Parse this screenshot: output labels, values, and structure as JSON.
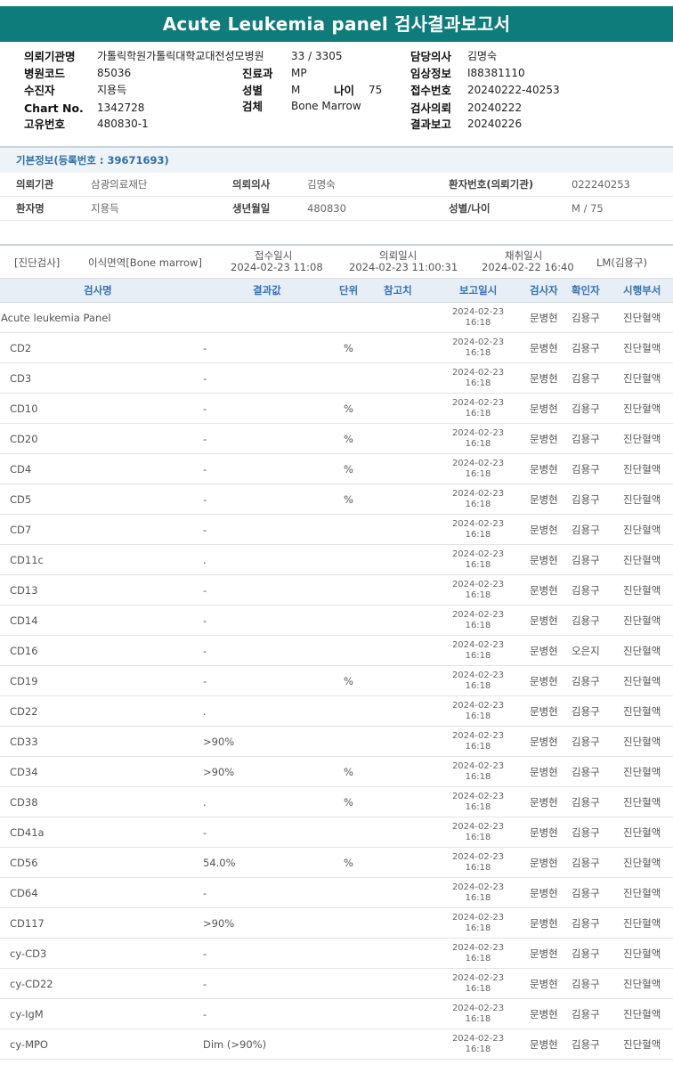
{
  "title": "Acute Leukemia panel 검사결과보고서",
  "header": {
    "institution_label": "의뢰기관명",
    "institution_value": "가톨릭학원가톨릭대학교대전성모병원",
    "ward_value": "33 / 3305",
    "doctor_label": "담당의사",
    "doctor_value": "김명숙",
    "hospital_code_label": "병원코드",
    "hospital_code_value": "85036",
    "dept_label": "진료과",
    "dept_value": "MP",
    "clinical_label": "임상정보",
    "clinical_value": "I88381110",
    "patient_label": "수진자",
    "patient_value": "지용득",
    "sex_label": "성별",
    "sex_value": "M",
    "age_label": "나이",
    "age_value": "75",
    "receipt_label": "접수번호",
    "receipt_value": "20240222-40253",
    "chart_label": "Chart No.",
    "chart_value": "1342728",
    "specimen_label": "검체",
    "specimen_value": "Bone Marrow",
    "request_label": "검사의뢰",
    "request_value": "20240222",
    "unique_label": "고유번호",
    "unique_value": "480830-1",
    "report_label": "결과보고",
    "report_value": "20240226"
  },
  "basic_info": {
    "title": "기본정보(등록번호 : 39671693)",
    "institution_label": "의뢰기관",
    "institution_value": "삼광의료재단",
    "doctor_label": "의뢰의사",
    "doctor_value": "김명숙",
    "patient_no_label": "환자번호(의뢰기관)",
    "patient_no_value": "022240253",
    "name_label": "환자명",
    "name_value": "지용득",
    "birth_label": "생년월일",
    "birth_value": "480830",
    "sexage_label": "성별/나이",
    "sexage_value": "M / 75"
  },
  "specimen_line": {
    "category": "[진단검사]",
    "specimen": "이식면역[Bone marrow]",
    "receipt_label": "접수일시",
    "receipt_value": "2024-02-23 11:08",
    "request_label": "의뢰일시",
    "request_value": "2024-02-23 11:00:31",
    "collect_label": "채취일시",
    "collect_value": "2024-02-22 16:40",
    "lm": "LM(김용구)"
  },
  "table": {
    "headers": {
      "name": "검사명",
      "result": "결과값",
      "unit": "단위",
      "ref": "참고치",
      "report_date": "보고일시",
      "tech": "검사자",
      "confirm": "확인자",
      "dept": "시행부서"
    },
    "rows": [
      {
        "name": "Acute leukemia Panel",
        "result": "",
        "unit": "",
        "date": "2024-02-23",
        "time": "16:18",
        "tech": "문병현",
        "confirm": "김용구",
        "dept": "진단혈액"
      },
      {
        "name": "CD2",
        "result": "-",
        "unit": "%",
        "date": "2024-02-23",
        "time": "16:18",
        "tech": "문병현",
        "confirm": "김용구",
        "dept": "진단혈액"
      },
      {
        "name": "CD3",
        "result": "-",
        "unit": "",
        "date": "2024-02-23",
        "time": "16:18",
        "tech": "문병현",
        "confirm": "김용구",
        "dept": "진단혈액"
      },
      {
        "name": "CD10",
        "result": "-",
        "unit": "%",
        "date": "2024-02-23",
        "time": "16:18",
        "tech": "문병현",
        "confirm": "김용구",
        "dept": "진단혈액"
      },
      {
        "name": "CD20",
        "result": "-",
        "unit": "%",
        "date": "2024-02-23",
        "time": "16:18",
        "tech": "문병현",
        "confirm": "김용구",
        "dept": "진단혈액"
      },
      {
        "name": "CD4",
        "result": "-",
        "unit": "%",
        "date": "2024-02-23",
        "time": "16:18",
        "tech": "문병현",
        "confirm": "김용구",
        "dept": "진단혈액"
      },
      {
        "name": "CD5",
        "result": "-",
        "unit": "%",
        "date": "2024-02-23",
        "time": "16:18",
        "tech": "문병현",
        "confirm": "김용구",
        "dept": "진단혈액"
      },
      {
        "name": "CD7",
        "result": "-",
        "unit": "",
        "date": "2024-02-23",
        "time": "16:18",
        "tech": "문병현",
        "confirm": "김용구",
        "dept": "진단혈액"
      },
      {
        "name": "CD11c",
        "result": ".",
        "unit": "",
        "date": "2024-02-23",
        "time": "16:18",
        "tech": "문병현",
        "confirm": "김용구",
        "dept": "진단혈액"
      },
      {
        "name": "CD13",
        "result": "-",
        "unit": "",
        "date": "2024-02-23",
        "time": "16:18",
        "tech": "문병현",
        "confirm": "김용구",
        "dept": "진단혈액"
      },
      {
        "name": "CD14",
        "result": "-",
        "unit": "",
        "date": "2024-02-23",
        "time": "16:18",
        "tech": "문병현",
        "confirm": "김용구",
        "dept": "진단혈액"
      },
      {
        "name": "CD16",
        "result": "-",
        "unit": "",
        "date": "2024-02-23",
        "time": "16:18",
        "tech": "문병현",
        "confirm": "오은지",
        "dept": "진단혈액"
      },
      {
        "name": "CD19",
        "result": "-",
        "unit": "%",
        "date": "2024-02-23",
        "time": "16:18",
        "tech": "문병현",
        "confirm": "김용구",
        "dept": "진단혈액"
      },
      {
        "name": "CD22",
        "result": ".",
        "unit": "",
        "date": "2024-02-23",
        "time": "16:18",
        "tech": "문병현",
        "confirm": "김용구",
        "dept": "진단혈액"
      },
      {
        "name": "CD33",
        "result": ">90%",
        "unit": "",
        "date": "2024-02-23",
        "time": "16:18",
        "tech": "문병현",
        "confirm": "김용구",
        "dept": "진단혈액"
      },
      {
        "name": "CD34",
        "result": ">90%",
        "unit": "%",
        "date": "2024-02-23",
        "time": "16:18",
        "tech": "문병현",
        "confirm": "김용구",
        "dept": "진단혈액"
      },
      {
        "name": "CD38",
        "result": ".",
        "unit": "%",
        "date": "2024-02-23",
        "time": "16:18",
        "tech": "문병현",
        "confirm": "김용구",
        "dept": "진단혈액"
      },
      {
        "name": "CD41a",
        "result": "-",
        "unit": "",
        "date": "2024-02-23",
        "time": "16:18",
        "tech": "문병현",
        "confirm": "김용구",
        "dept": "진단혈액"
      },
      {
        "name": "CD56",
        "result": "54.0%",
        "unit": "%",
        "date": "2024-02-23",
        "time": "16:18",
        "tech": "문병현",
        "confirm": "김용구",
        "dept": "진단혈액"
      },
      {
        "name": "CD64",
        "result": "-",
        "unit": "",
        "date": "2024-02-23",
        "time": "16:18",
        "tech": "문병현",
        "confirm": "김용구",
        "dept": "진단혈액"
      },
      {
        "name": "CD117",
        "result": ">90%",
        "unit": "",
        "date": "2024-02-23",
        "time": "16:18",
        "tech": "문병현",
        "confirm": "김용구",
        "dept": "진단혈액"
      },
      {
        "name": "cy-CD3",
        "result": "-",
        "unit": "",
        "date": "2024-02-23",
        "time": "16:18",
        "tech": "문병현",
        "confirm": "김용구",
        "dept": "진단혈액"
      },
      {
        "name": "cy-CD22",
        "result": "-",
        "unit": "",
        "date": "2024-02-23",
        "time": "16:18",
        "tech": "문병현",
        "confirm": "김용구",
        "dept": "진단혈액"
      },
      {
        "name": "cy-IgM",
        "result": "-",
        "unit": "",
        "date": "2024-02-23",
        "time": "16:18",
        "tech": "문병현",
        "confirm": "김용구",
        "dept": "진단혈액"
      },
      {
        "name": "cy-MPO",
        "result": "Dim (>90%)",
        "unit": "",
        "date": "2024-02-23",
        "time": "16:18",
        "tech": "문병현",
        "confirm": "김용구",
        "dept": "진단혈액"
      }
    ]
  }
}
